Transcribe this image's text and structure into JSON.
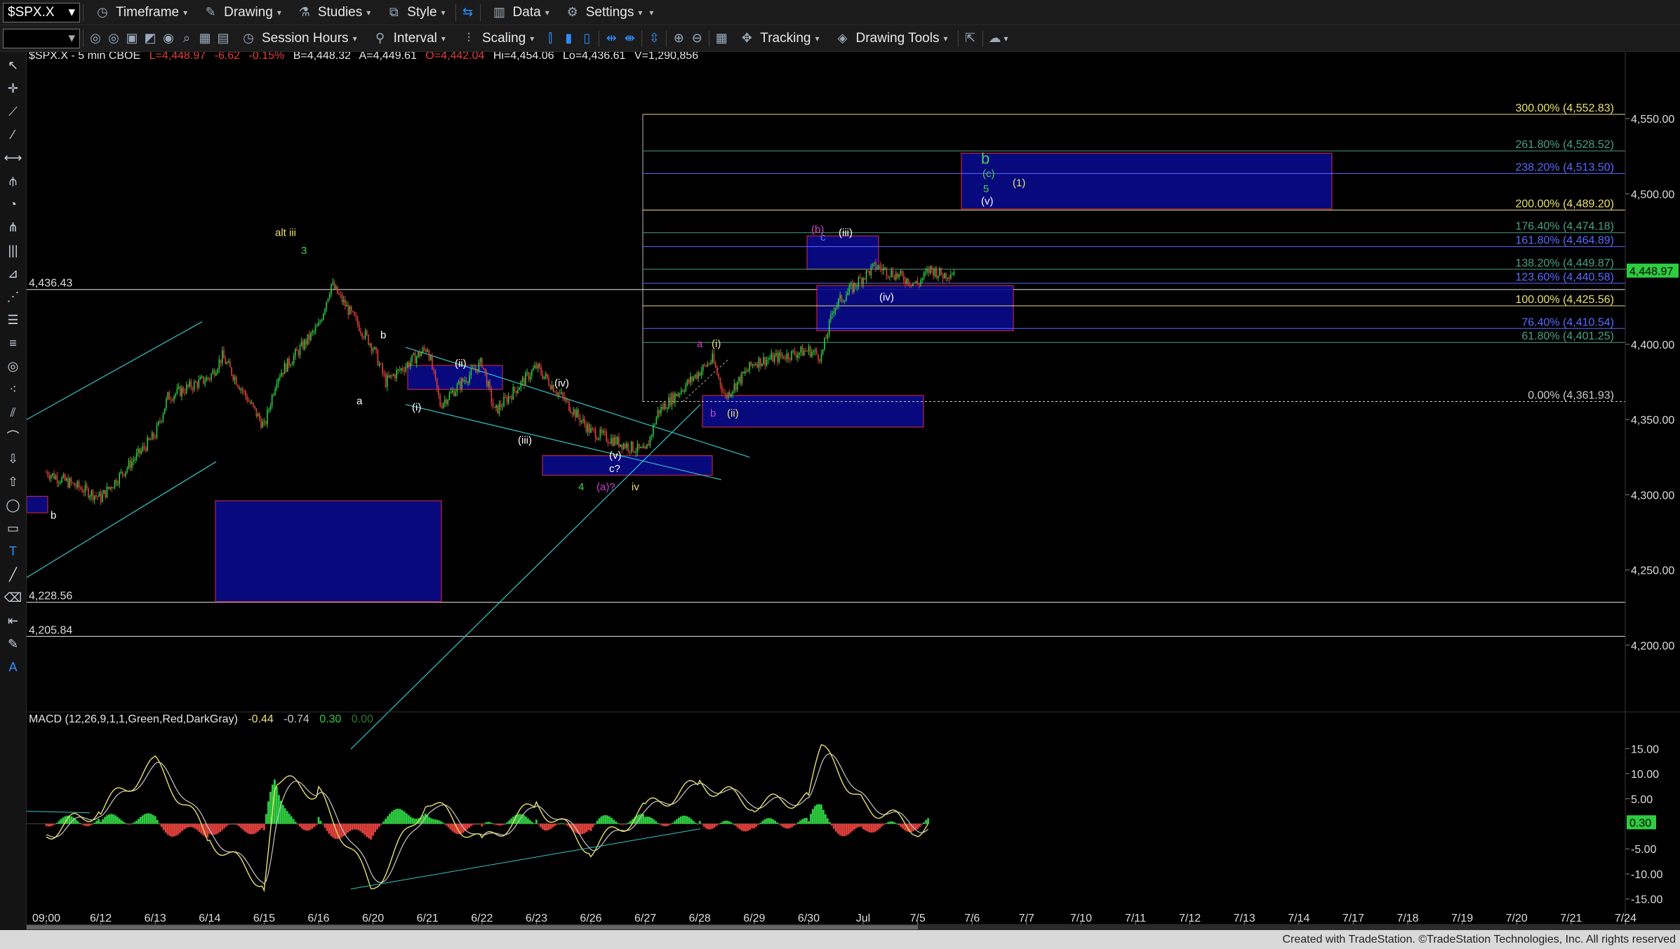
{
  "toolbar": {
    "symbol": "$SPX.X",
    "timeframe": "Timeframe",
    "drawing": "Drawing",
    "studies": "Studies",
    "style": "Style",
    "data": "Data",
    "settings": "Settings",
    "session_hours": "Session Hours",
    "interval": "Interval",
    "scaling": "Scaling",
    "tracking": "Tracking",
    "drawing_tools": "Drawing Tools"
  },
  "header": {
    "symbol_line": "$SPX.X - 5 min  CBOE",
    "last": "L=4,448.97",
    "change": "-6.62",
    "change_pct": "-0.15%",
    "bid": "B=4,448.32",
    "ask": "A=4,449.61",
    "open": "O=4,442.04",
    "high": "Hi=4,454.06",
    "low": "Lo=4,436.61",
    "volume": "V=1,290,856"
  },
  "macd_header": {
    "name": "MACD (12,26,9,1,1,Green,Red,DarkGray)",
    "v1": "-0.44",
    "v2": "-0.74",
    "v3": "0.30",
    "v4": "0.00"
  },
  "footer": {
    "credit": "Created with TradeStation. ©TradeStation Technologies, Inc. All rights reserved"
  },
  "colors": {
    "up": "#2ecc40",
    "down": "#e0403a",
    "box": "#0a0a8c",
    "box_border": "#d22a4a",
    "fib": "#e8e070",
    "fib_green": "#4aa080",
    "fib_blue": "#5a6aff",
    "trend": "#37c5c8",
    "macd_line": "#e8e070",
    "signal_line": "#c8c8c8",
    "price_tag": "#2ecc40"
  },
  "chart_data": [
    {
      "type": "candlestick",
      "symbol": "$SPX.X",
      "interval": "5 min",
      "x_ticks": [
        "09:00",
        "6/12",
        "6/13",
        "6/14",
        "6/15",
        "6/16",
        "6/20",
        "6/21",
        "6/22",
        "6/23",
        "6/26",
        "6/27",
        "6/28",
        "6/29",
        "6/30",
        "Jul",
        "7/5",
        "7/6",
        "7/7",
        "7/10",
        "7/11",
        "7/12",
        "7/13",
        "7/14",
        "7/17",
        "7/18",
        "7/19",
        "7/20",
        "7/21",
        "7/24"
      ],
      "y_ticks": [
        "4,550.00",
        "4,500.00",
        "4,450.00",
        "4,400.00",
        "4,350.00",
        "4,300.00",
        "4,250.00",
        "4,200.00"
      ],
      "ylim": [
        4165,
        4585
      ],
      "last_price": "4,448.97",
      "key_path": [
        [
          "09:00",
          4315
        ],
        [
          "6/12",
          4298
        ],
        [
          "6/13",
          4340
        ],
        [
          "6/13",
          4365
        ],
        [
          "6/14",
          4378
        ],
        [
          "6/14",
          4392
        ],
        [
          "6/15",
          4345
        ],
        [
          "6/15",
          4378
        ],
        [
          "6/16",
          4412
        ],
        [
          "6/16",
          4440
        ],
        [
          "6/20",
          4398
        ],
        [
          "6/20",
          4375
        ],
        [
          "6/21",
          4398
        ],
        [
          "6/21",
          4360
        ],
        [
          "6/22",
          4388
        ],
        [
          "6/22",
          4355
        ],
        [
          "6/23",
          4385
        ],
        [
          "6/26",
          4342
        ],
        [
          "6/27",
          4328
        ],
        [
          "6/27",
          4355
        ],
        [
          "6/28",
          4382
        ],
        [
          "6/28",
          4390
        ],
        [
          "6/28",
          4365
        ],
        [
          "6/29",
          4388
        ],
        [
          "6/30",
          4396
        ],
        [
          "6/30",
          4392
        ],
        [
          "6/30",
          4425
        ],
        [
          "Jul",
          4445
        ],
        [
          "Jul",
          4452
        ],
        [
          "7/5",
          4440
        ],
        [
          "7/5",
          4450
        ],
        [
          "7/5",
          4446
        ],
        [
          "7/5",
          4449
        ]
      ],
      "horizontal_lines": [
        {
          "label": "4,436.43",
          "value": 4436.43
        },
        {
          "label": "4,228.56",
          "value": 4228.56
        },
        {
          "label": "4,205.84",
          "value": 4205.84
        }
      ],
      "fib_levels": [
        {
          "label": "300.00% (4,552.83)",
          "value": 4552.83,
          "color": "yellow"
        },
        {
          "label": "261.80% (4,528.52)",
          "value": 4528.52,
          "color": "green"
        },
        {
          "label": "238.20% (4,513.50)",
          "value": 4513.5,
          "color": "blue"
        },
        {
          "label": "200.00% (4,489.20)",
          "value": 4489.2,
          "color": "yellow"
        },
        {
          "label": "176.40% (4,474.18)",
          "value": 4474.18,
          "color": "green"
        },
        {
          "label": "161.80% (4,464.89)",
          "value": 4464.89,
          "color": "blue"
        },
        {
          "label": "138.20% (4,449.87)",
          "value": 4449.87,
          "color": "green"
        },
        {
          "label": "123.60% (4,440.58)",
          "value": 4440.58,
          "color": "blue"
        },
        {
          "label": "100.00% (4,425.56)",
          "value": 4425.56,
          "color": "yellow"
        },
        {
          "label": "76.40% (4,410.54)",
          "value": 4410.54,
          "color": "blue"
        },
        {
          "label": "61.80% (4,401.25)",
          "value": 4401.25,
          "color": "green"
        },
        {
          "label": "0.00% (4,361.93)",
          "value": 4361.93,
          "color": "white"
        }
      ],
      "wave_labels": [
        {
          "text": "alt iii",
          "color": "yellow"
        },
        {
          "text": "3",
          "color": "green"
        },
        {
          "text": "b",
          "color": "white"
        },
        {
          "text": "a",
          "color": "white"
        },
        {
          "text": "(i)",
          "color": "white"
        },
        {
          "text": "(ii)",
          "color": "white"
        },
        {
          "text": "(iii)",
          "color": "white"
        },
        {
          "text": "(iv)",
          "color": "white"
        },
        {
          "text": "(v)",
          "color": "white"
        },
        {
          "text": "c?",
          "color": "white"
        },
        {
          "text": "4",
          "color": "green"
        },
        {
          "text": "(a)?",
          "color": "magenta"
        },
        {
          "text": "iv",
          "color": "yellow"
        },
        {
          "text": "a",
          "color": "magenta"
        },
        {
          "text": "(i)",
          "color": "yellow"
        },
        {
          "text": "b",
          "color": "magenta"
        },
        {
          "text": "(ii)",
          "color": "yellow"
        },
        {
          "text": "(b)",
          "color": "magenta"
        },
        {
          "text": "c",
          "color": "blue"
        },
        {
          "text": "(iii)",
          "color": "white"
        },
        {
          "text": "(iv)",
          "color": "white"
        },
        {
          "text": "b",
          "color": "green"
        },
        {
          "text": "(c)",
          "color": "green"
        },
        {
          "text": "5",
          "color": "green"
        },
        {
          "text": "(v)",
          "color": "white"
        },
        {
          "text": "(1)",
          "color": "yellow"
        },
        {
          "text": "b",
          "color": "white"
        }
      ]
    },
    {
      "type": "line",
      "name": "MACD (12,26,9,1,1,Green,Red,DarkGray)",
      "y_ticks": [
        "15.00",
        "10.00",
        "5.00",
        "0.30",
        "-5.00",
        "-10.00",
        "-15.00"
      ],
      "ylim": [
        -17,
        17
      ],
      "last_value": "0.30",
      "macd_path": [
        [
          "09:00",
          -2
        ],
        [
          "6/12",
          3
        ],
        [
          "6/13",
          12
        ],
        [
          "6/14",
          -3
        ],
        [
          "6/15",
          -12
        ],
        [
          "6/15",
          9
        ],
        [
          "6/16",
          6
        ],
        [
          "6/20",
          -13
        ],
        [
          "6/21",
          5
        ],
        [
          "6/22",
          -4
        ],
        [
          "6/23",
          4
        ],
        [
          "6/26",
          -5
        ],
        [
          "6/27",
          3
        ],
        [
          "6/28",
          8
        ],
        [
          "6/29",
          4
        ],
        [
          "6/30",
          5
        ],
        [
          "6/30",
          15
        ],
        [
          "Jul",
          4
        ],
        [
          "7/5",
          -1
        ],
        [
          "7/5",
          0.3
        ]
      ]
    }
  ]
}
